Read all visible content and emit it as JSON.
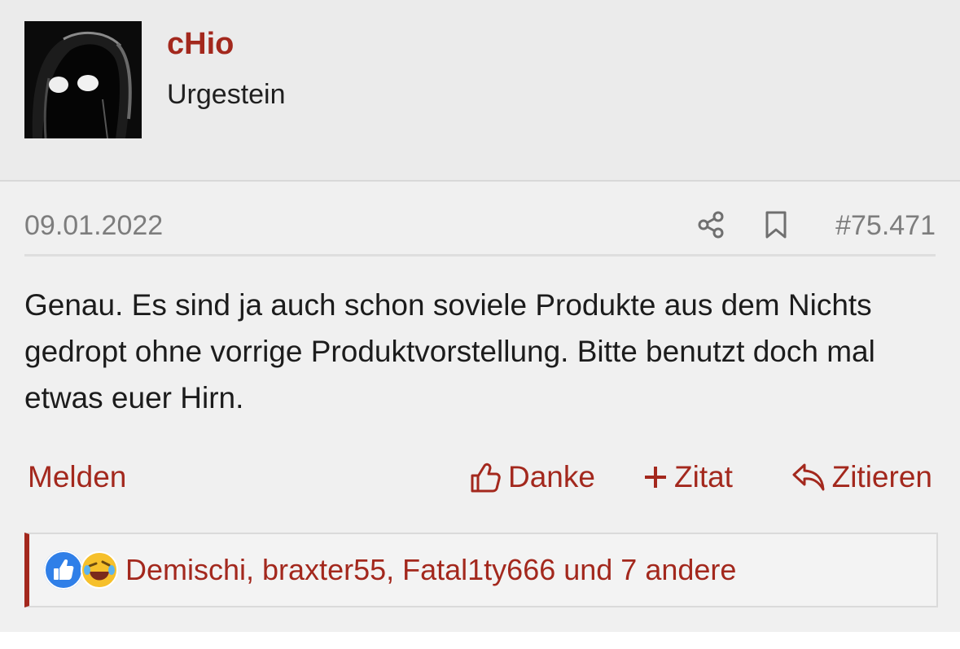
{
  "user": {
    "name": "cHio",
    "title": "Urgestein"
  },
  "post": {
    "date": "09.01.2022",
    "number": "#75.471",
    "text": "Genau. Es sind ja auch schon soviele Produkte aus dem Nichts gedropt ohne vorrige Produktvorstellung. Bitte benutzt doch mal etwas euer Hirn."
  },
  "actions": {
    "report": "Melden",
    "thanks": "Danke",
    "quote_add": "Zitat",
    "reply": "Zitieren"
  },
  "reactions": {
    "icons": [
      "thumbs-up-reaction-icon",
      "laughing-reaction-icon"
    ],
    "names": "Demischi, braxter55, Fatal1ty666 und 7 andere"
  },
  "colors": {
    "accent": "#a3281d",
    "muted": "#7d7d7d",
    "like": "#2f7fe8"
  }
}
